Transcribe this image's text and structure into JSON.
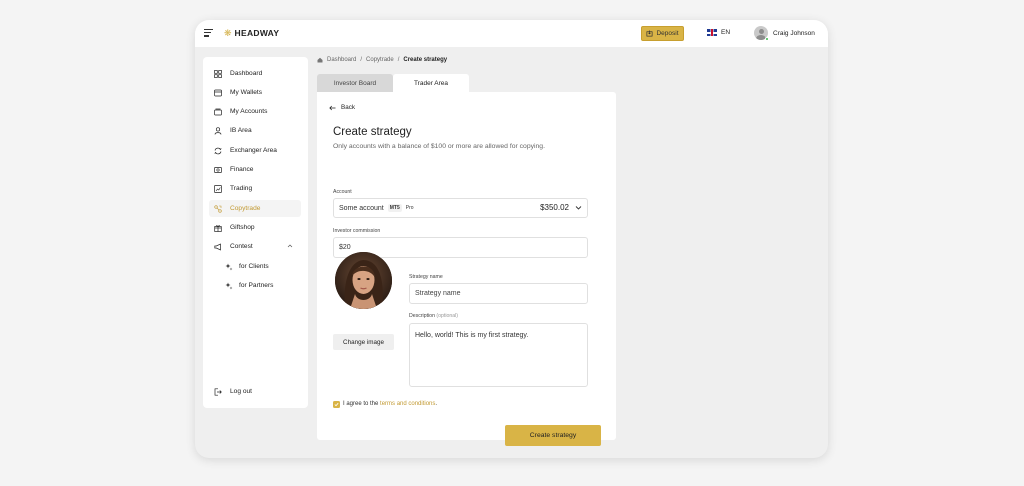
{
  "header": {
    "logo_text": "HEADWAY",
    "deposit_label": "Deposit",
    "language": "EN",
    "user_name": "Craig Johnson"
  },
  "sidebar": {
    "items": [
      {
        "label": "Dashboard",
        "icon": "grid-icon"
      },
      {
        "label": "My Wallets",
        "icon": "wallet-icon"
      },
      {
        "label": "My Accounts",
        "icon": "accounts-icon"
      },
      {
        "label": "IB Area",
        "icon": "person-icon"
      },
      {
        "label": "Exchanger Area",
        "icon": "exchange-icon"
      },
      {
        "label": "Finance",
        "icon": "finance-icon"
      },
      {
        "label": "Trading",
        "icon": "chart-icon"
      },
      {
        "label": "Copytrade",
        "icon": "copytrade-icon"
      },
      {
        "label": "Giftshop",
        "icon": "gift-icon"
      },
      {
        "label": "Contest",
        "icon": "megaphone-icon"
      },
      {
        "label": "for Clients",
        "icon": "sparkle-icon"
      },
      {
        "label": "for Partners",
        "icon": "sparkle-icon"
      }
    ],
    "logout_label": "Log out"
  },
  "breadcrumb": {
    "items": [
      "Dashboard",
      "Copytrade",
      "Create strategy"
    ]
  },
  "tabs": [
    "Investor Board",
    "Trader Area"
  ],
  "form": {
    "back_label": "Back",
    "title": "Create strategy",
    "subtitle": "Only accounts with a balance of $100 or more are allowed for copying.",
    "account_label": "Account",
    "account_name": "Some account",
    "account_platform": "MT5",
    "account_type": "Pro",
    "account_balance": "$350.02",
    "commission_label": "Investor commission",
    "commission_value": "$20",
    "strategy_name_label": "Strategy name",
    "strategy_name_value": "Strategy name",
    "description_label": "Description",
    "description_optional": "(optional)",
    "description_value": "Hello, world! This is my first strategy.",
    "change_image_label": "Change image",
    "agree_prefix": "I agree to the",
    "agree_link": "terms and conditions",
    "agree_suffix": ".",
    "submit_label": "Create strategy"
  },
  "colors": {
    "accent": "#d9b446",
    "accent_text": "#c29a33"
  }
}
